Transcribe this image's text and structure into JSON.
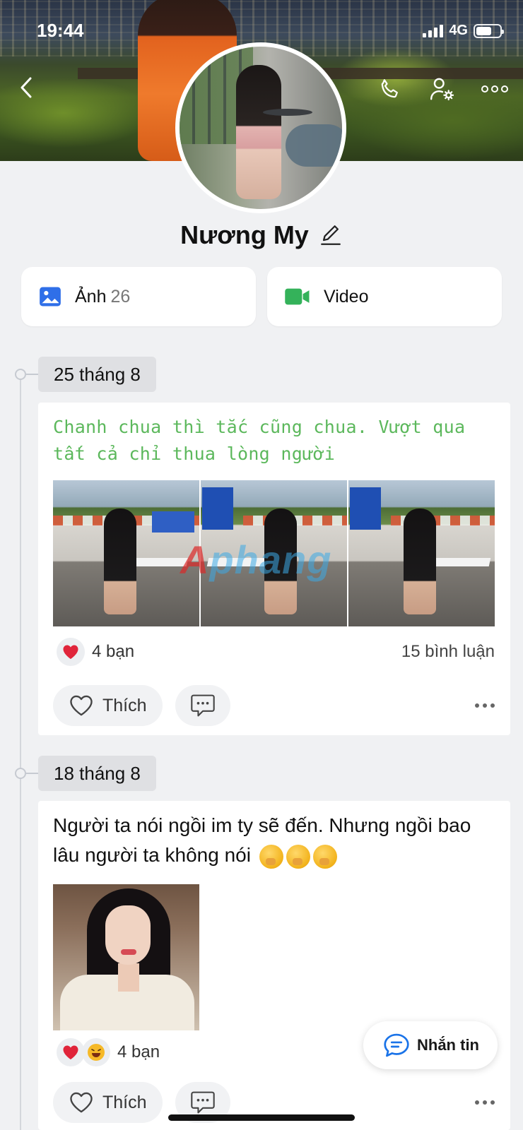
{
  "status_bar": {
    "time": "19:44",
    "network": "4G",
    "battery_level": 0.65
  },
  "profile": {
    "name": "Nương My"
  },
  "media": {
    "photos_label": "Ảnh",
    "photos_count": "26",
    "video_label": "Video"
  },
  "posts": [
    {
      "date": "25 tháng 8",
      "text": "Chanh chua thì tắc cũng chua. Vượt qua tất cả chỉ thua lòng người",
      "watermark_a": "A",
      "watermark_rest": "phang",
      "reactions_count": "4 bạn",
      "comments_count": "15 bình luận",
      "like_label": "Thích"
    },
    {
      "date": "18 tháng 8",
      "text": "Người ta nói ngồi im ty sẽ đến. Nhưng ngồi bao lâu người ta không nói",
      "reactions_count": "4 bạn",
      "like_label": "Thích"
    }
  ],
  "chat_button": {
    "label": "Nhắn tin"
  },
  "colors": {
    "accent": "#1a73e8",
    "post_green": "#5cb85c",
    "heart": "#e0243a",
    "video_green": "#34b25a"
  },
  "icons": [
    "back-icon",
    "phone-icon",
    "user-settings-icon",
    "more-icon",
    "edit-icon",
    "photo-icon",
    "video-camera-icon",
    "heart-icon",
    "comment-icon",
    "chat-bubble-icon"
  ]
}
